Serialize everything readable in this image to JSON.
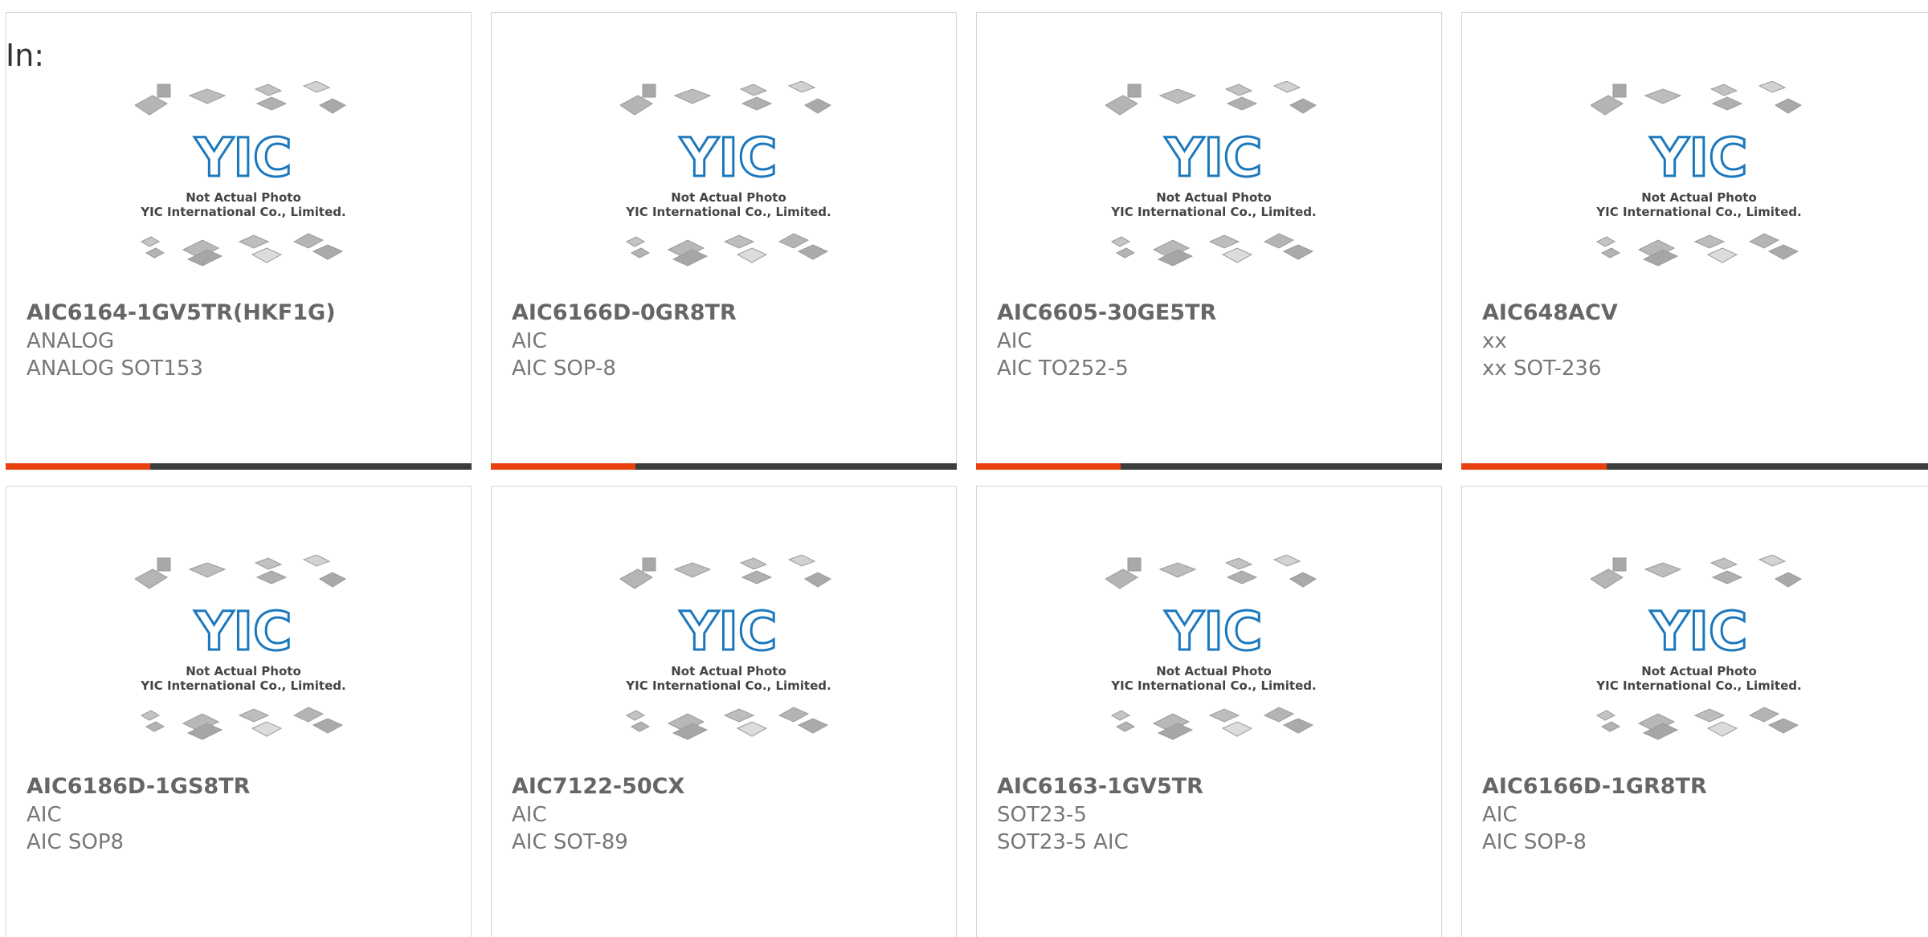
{
  "filter_label": "In:",
  "thumbnail": {
    "caption_line1": "Not Actual Photo",
    "caption_line2": "YIC International Co., Limited.",
    "logo_text": "YIC",
    "logo_color": "#1b78bd"
  },
  "accent_color": "#e8410f",
  "bar_color": "#3d3d3d",
  "accent_fraction": 0.31,
  "products": [
    {
      "part": "AIC6164-1GV5TR(HKF1G)",
      "brand": "ANALOG",
      "package": "ANALOG SOT153"
    },
    {
      "part": "AIC6166D-0GR8TR",
      "brand": "AIC",
      "package": "AIC SOP-8"
    },
    {
      "part": "AIC6605-30GE5TR",
      "brand": "AIC",
      "package": "AIC TO252-5"
    },
    {
      "part": "AIC648ACV",
      "brand": "xx",
      "package": "xx SOT-236"
    },
    {
      "part": "AIC6186D-1GS8TR",
      "brand": "AIC",
      "package": "AIC SOP8"
    },
    {
      "part": "AIC7122-50CX",
      "brand": "AIC",
      "package": "AIC SOT-89"
    },
    {
      "part": "AIC6163-1GV5TR",
      "brand": "SOT23-5",
      "package": "SOT23-5 AIC"
    },
    {
      "part": "AIC6166D-1GR8TR",
      "brand": "AIC",
      "package": "AIC SOP-8"
    }
  ]
}
